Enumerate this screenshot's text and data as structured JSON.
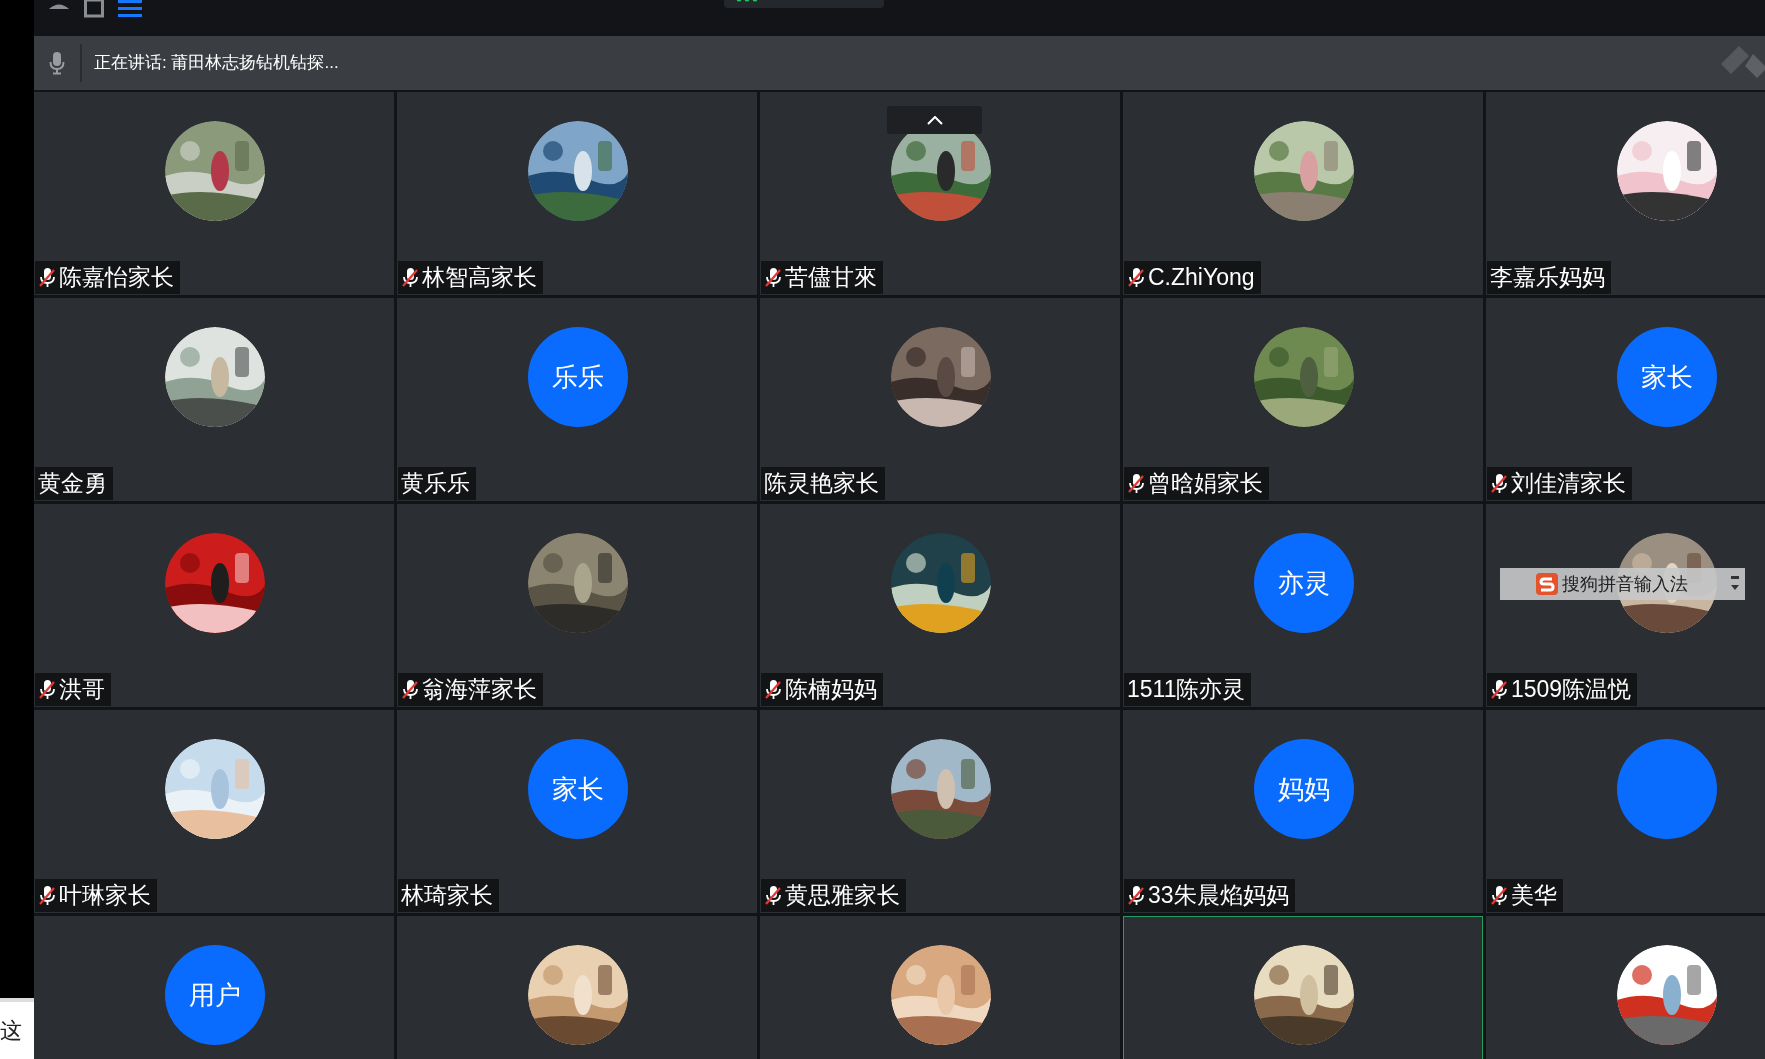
{
  "top_bar": {
    "menu_active": true
  },
  "speaking_bar": {
    "text": "正在讲话: 莆田林志扬钻机钻探..."
  },
  "tiles": [
    {
      "name": "陈嘉怡家长",
      "muted": true,
      "speaking": false
    },
    {
      "name": "林智高家长",
      "muted": true,
      "speaking": false
    },
    {
      "name": "苦儘甘來",
      "muted": true,
      "speaking": false
    },
    {
      "name": "C.ZhiYong",
      "muted": true,
      "speaking": false
    },
    {
      "name": "李嘉乐妈妈",
      "muted": false,
      "speaking": false
    },
    {
      "name": "黄金勇",
      "muted": false,
      "speaking": false
    },
    {
      "name": "黄乐乐",
      "muted": false,
      "speaking": false,
      "avatar": {
        "kind": "initials",
        "text": "乐乐"
      }
    },
    {
      "name": "陈灵艳家长",
      "muted": false,
      "speaking": false
    },
    {
      "name": "曾晗娟家长",
      "muted": true,
      "speaking": false
    },
    {
      "name": "刘佳清家长",
      "muted": true,
      "speaking": false,
      "avatar": {
        "kind": "initials",
        "text": "家长"
      }
    },
    {
      "name": "洪哥",
      "muted": true,
      "speaking": false
    },
    {
      "name": "翁海萍家长",
      "muted": true,
      "speaking": false
    },
    {
      "name": "陈楠妈妈",
      "muted": true,
      "speaking": false
    },
    {
      "name": "1511陈亦灵",
      "muted": false,
      "speaking": false,
      "avatar": {
        "kind": "initials",
        "text": "亦灵"
      }
    },
    {
      "name": "1509陈温悦",
      "muted": true,
      "speaking": false
    },
    {
      "name": "叶琳家长",
      "muted": true,
      "speaking": false
    },
    {
      "name": "林琦家长",
      "muted": false,
      "speaking": false,
      "avatar": {
        "kind": "initials",
        "text": "家长"
      }
    },
    {
      "name": "黄思雅家长",
      "muted": true,
      "speaking": false
    },
    {
      "name": "33朱晨焰妈妈",
      "muted": true,
      "speaking": false,
      "avatar": {
        "kind": "initials",
        "text": "妈妈"
      }
    },
    {
      "name": "美华",
      "muted": true,
      "speaking": false,
      "avatar": {
        "kind": "initials"
      }
    },
    {
      "speaking": false,
      "avatar": {
        "kind": "initials",
        "text": "用户"
      }
    },
    {
      "speaking": false
    },
    {
      "speaking": false
    },
    {
      "speaking": true
    },
    {
      "speaking": false
    }
  ],
  "ime_bar": {
    "text": "搜狗拼音输入法"
  },
  "side_window": {
    "text": "这"
  }
}
